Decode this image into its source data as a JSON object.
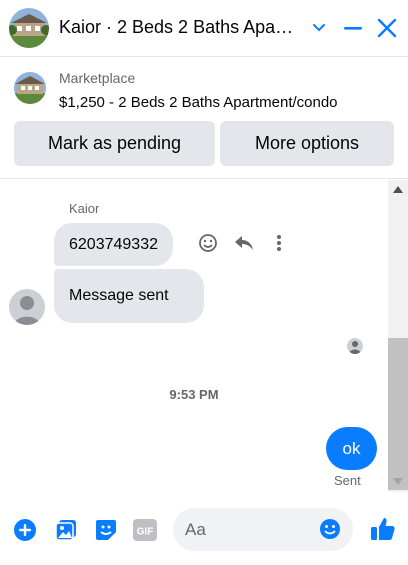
{
  "header": {
    "title": "Kaior · 2 Beds 2 Baths Apartment/condo",
    "icons": {
      "minimize": "chevron-down-icon",
      "dock": "minus-icon",
      "close": "close-icon"
    }
  },
  "listing": {
    "label": "Marketplace",
    "title": "$1,250 - 2 Beds 2 Baths Apartment/condo",
    "pending_button": "Mark as pending",
    "more_button": "More options"
  },
  "conversation": {
    "sender_name": "Kaior",
    "messages_in": [
      "6203749332",
      "Message sent"
    ],
    "timestamp": "9:53 PM",
    "message_out": "ok",
    "status": "Sent"
  },
  "composer": {
    "placeholder": "Aa",
    "icons": [
      "plus-circle-icon",
      "photo-icon",
      "sticker-icon",
      "gif-icon",
      "emoji-icon",
      "like-icon"
    ]
  },
  "colors": {
    "accent": "#0a7cff",
    "bubble_in": "#e4e6eb",
    "muted_text": "#65676b"
  }
}
